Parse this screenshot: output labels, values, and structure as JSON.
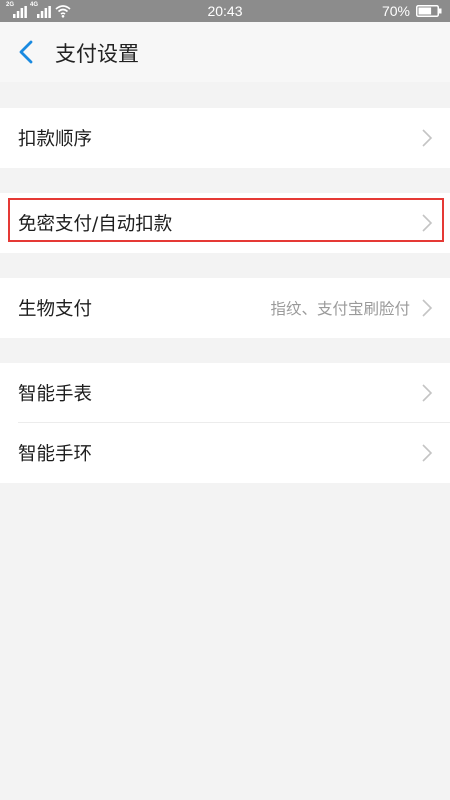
{
  "status_bar": {
    "time": "20:43",
    "battery": "70%",
    "net_1": "2G",
    "net_2": "4G",
    "battery_level": 0.7
  },
  "header": {
    "title": "支付设置",
    "back_icon": "chevron-left-icon"
  },
  "settings": {
    "deduction_order": {
      "label": "扣款顺序"
    },
    "password_free": {
      "label": "免密支付/自动扣款"
    },
    "biometric": {
      "label": "生物支付",
      "value": "指纹、支付宝刷脸付"
    },
    "smart_watch": {
      "label": "智能手表"
    },
    "smart_band": {
      "label": "智能手环"
    }
  },
  "colors": {
    "accent": "#1a8ae0",
    "highlight_border": "#e53935",
    "background": "#f3f3f3"
  }
}
